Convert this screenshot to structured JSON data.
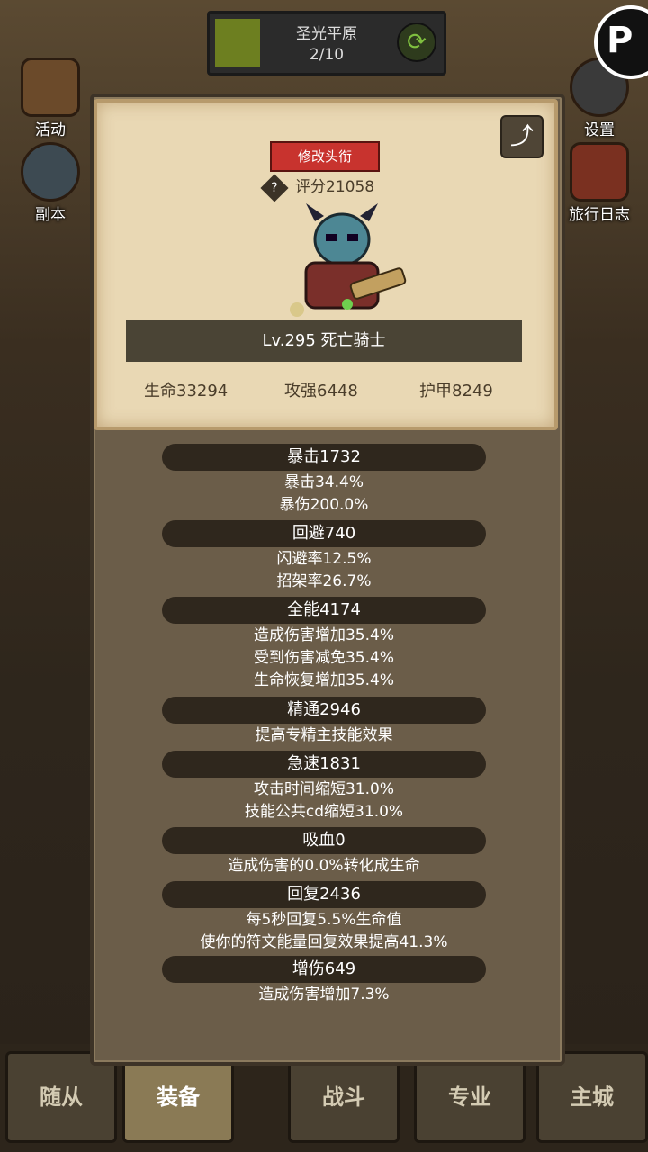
{
  "stage": {
    "name": "圣光平原",
    "progress": "2/10"
  },
  "left_buttons": [
    {
      "label": "活动",
      "icon": "book-icon"
    },
    {
      "label": "副本",
      "icon": "portal-icon"
    }
  ],
  "right_buttons": [
    {
      "label": "设置",
      "icon": "gear-icon"
    },
    {
      "label": "旅行日志",
      "icon": "journal-icon"
    }
  ],
  "popup": {
    "edit_title_label": "修改头衔",
    "score_label": "评分21058",
    "hero_name": "Lv.295 死亡骑士",
    "base_stats": {
      "hp": "生命33294",
      "atk": "攻强6448",
      "armor": "护甲8249"
    },
    "stat_groups": [
      {
        "header": "暴击1732",
        "lines": [
          "暴击34.4%",
          "暴伤200.0%"
        ]
      },
      {
        "header": "回避740",
        "lines": [
          "闪避率12.5%",
          "招架率26.7%"
        ]
      },
      {
        "header": "全能4174",
        "lines": [
          "造成伤害增加35.4%",
          "受到伤害减免35.4%",
          "生命恢复增加35.4%"
        ]
      },
      {
        "header": "精通2946",
        "lines": [
          "提高专精主技能效果"
        ]
      },
      {
        "header": "急速1831",
        "lines": [
          "攻击时间缩短31.0%",
          "技能公共cd缩短31.0%"
        ]
      },
      {
        "header": "吸血0",
        "lines": [
          "造成伤害的0.0%转化成生命"
        ]
      },
      {
        "header": "回复2436",
        "lines": [
          "每5秒回复5.5%生命值",
          "使你的符文能量回复效果提高41.3%"
        ]
      },
      {
        "header": "增伤649",
        "lines": [
          "造成伤害增加7.3%"
        ]
      }
    ]
  },
  "bottom_nav": [
    {
      "label": "随从",
      "active": false
    },
    {
      "label": "装备",
      "active": true
    },
    {
      "label": "战斗",
      "active": false
    },
    {
      "label": "专业",
      "active": false
    },
    {
      "label": "主城",
      "active": false
    }
  ],
  "colors": {
    "title_button": "#c8332e",
    "parchment": "#e9d8b4",
    "stat_header": "#2f271d"
  }
}
